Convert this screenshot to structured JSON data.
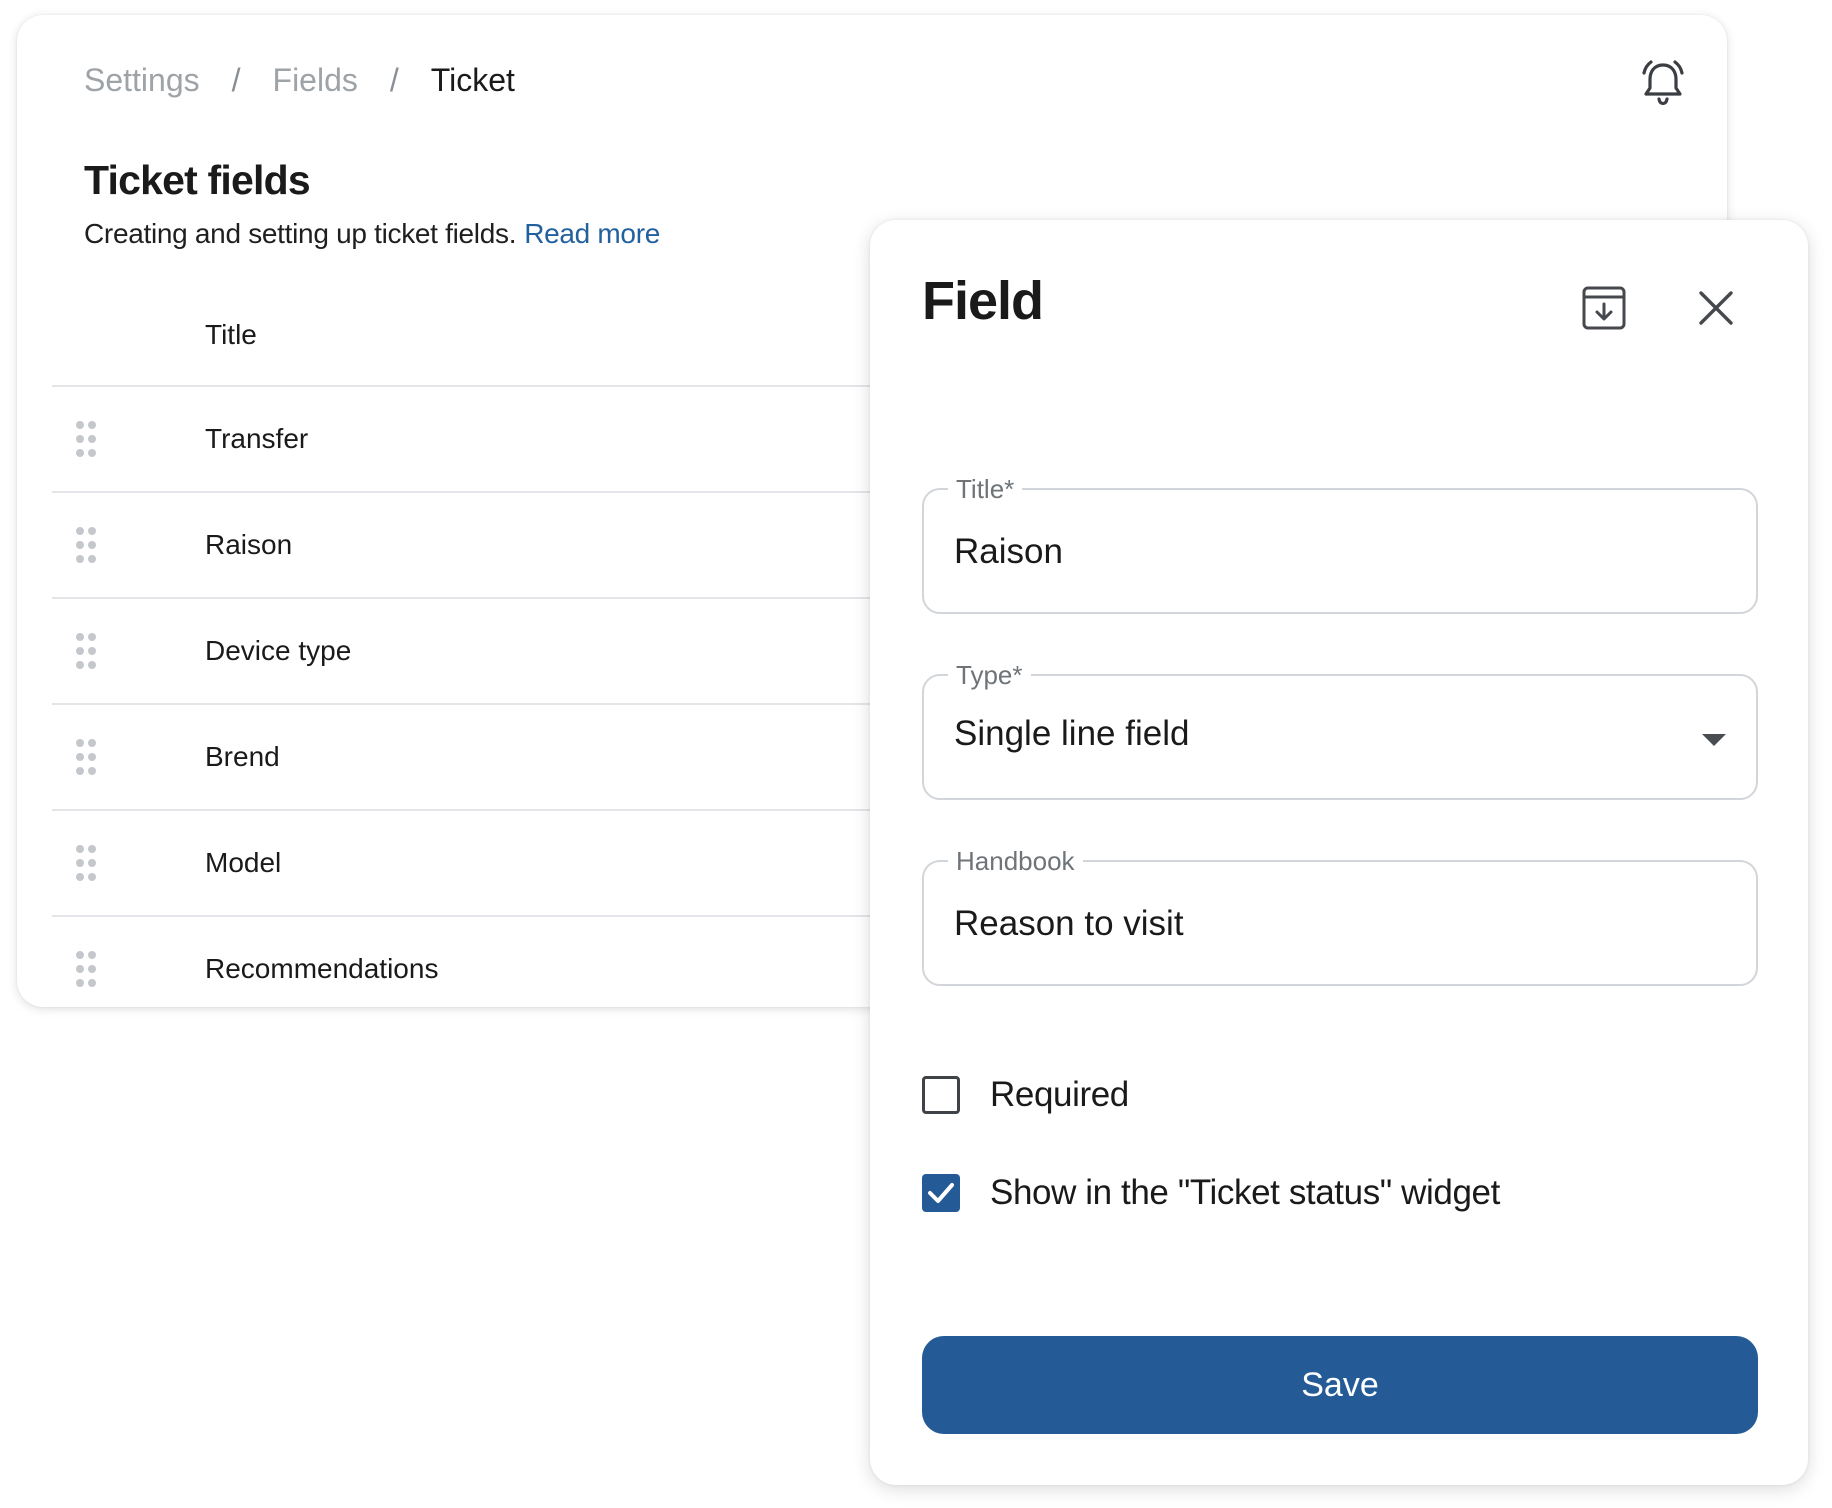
{
  "breadcrumb": {
    "items": [
      "Settings",
      "Fields"
    ],
    "current": "Ticket",
    "separator": "/"
  },
  "header": {
    "title": "Ticket fields",
    "description": "Creating and setting up ticket fields.",
    "read_more": "Read more"
  },
  "table": {
    "column_title": "Title",
    "rows": [
      "Transfer",
      "Raison",
      "Device type",
      "Brend",
      "Model",
      "Recommendations"
    ]
  },
  "panel": {
    "title": "Field",
    "title_field": {
      "label": "Title*",
      "value": "Raison"
    },
    "type_field": {
      "label": "Type*",
      "value": "Single line field"
    },
    "handbook_field": {
      "label": "Handbook",
      "value": "Reason to visit"
    },
    "required": {
      "label": "Required",
      "checked": false
    },
    "show_widget": {
      "label": "Show in the \"Ticket status\" widget",
      "checked": true
    },
    "save_label": "Save"
  },
  "colors": {
    "accent": "#245b97",
    "link": "#23609e",
    "muted_text": "#9ea3a8",
    "divider": "#e3e5e8"
  },
  "icons": {
    "bell": "bell-ringing-icon",
    "archive": "archive-download-icon",
    "close": "close-icon",
    "drag": "drag-handle-icon",
    "dropdown": "chevron-down-icon"
  }
}
